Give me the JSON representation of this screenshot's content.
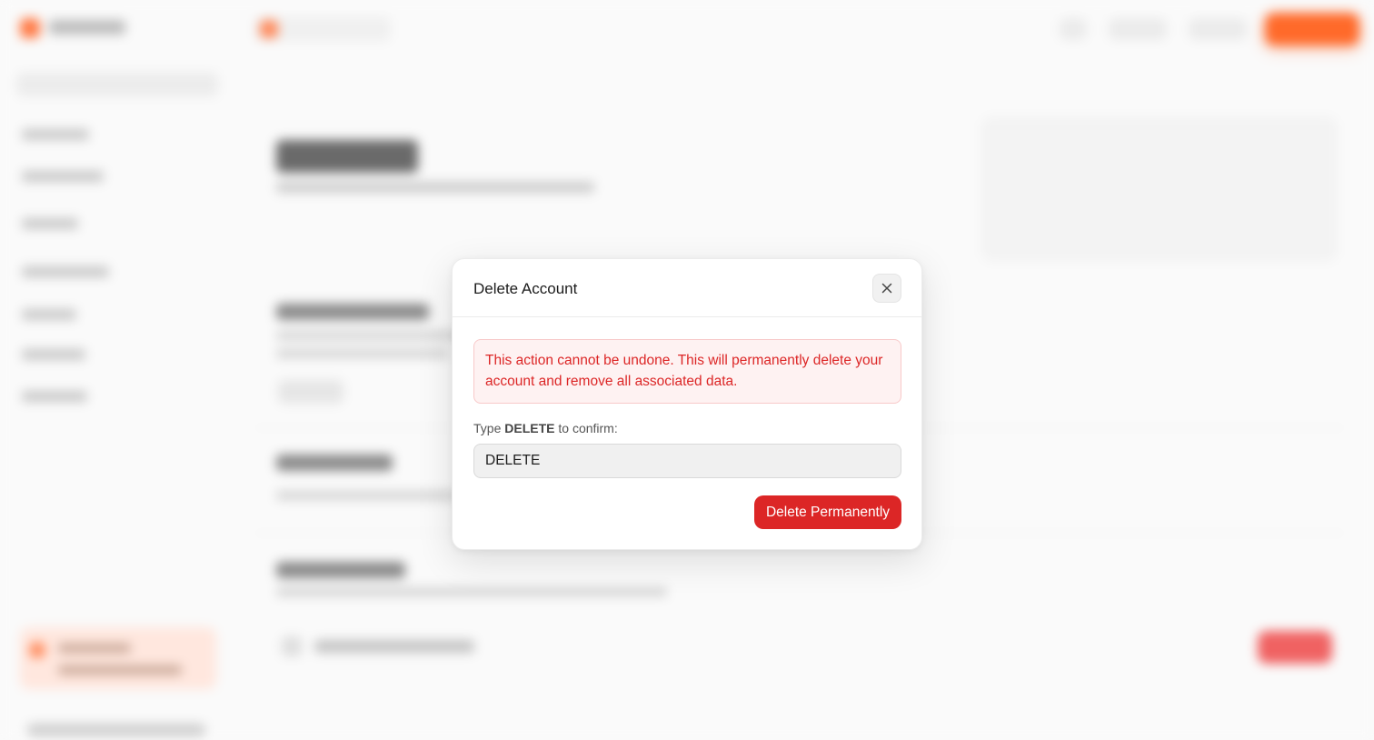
{
  "modal": {
    "title": "Delete Account",
    "close_icon": "close-icon",
    "warning": "This action cannot be undone. This will permanently delete your account and remove all associated data.",
    "confirm_prefix": "Type ",
    "confirm_keyword": "DELETE",
    "confirm_suffix": " to confirm:",
    "input_value": "DELETE",
    "delete_button": "Delete Permanently"
  },
  "colors": {
    "danger": "#dc2626",
    "danger_bg": "#fef2f2",
    "accent": "#ff6a2a"
  }
}
